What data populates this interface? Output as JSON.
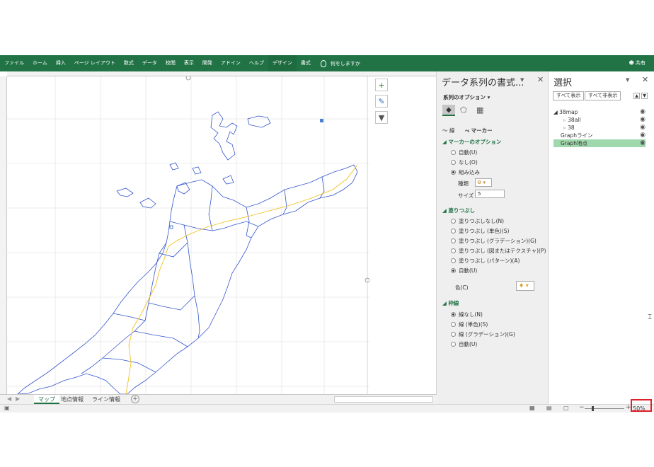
{
  "ribbon": {
    "tabs": [
      "ファイル",
      "ホーム",
      "挿入",
      "ページ レイアウト",
      "数式",
      "データ",
      "校閲",
      "表示",
      "開発",
      "アドイン",
      "ヘルプ",
      "デザイン",
      "書式"
    ],
    "tell_me": "何をしますか",
    "share": "共有"
  },
  "format_pane": {
    "title": "データ系列の書式...",
    "series_options": "系列のオプション",
    "line_tab": "線",
    "marker_tab": "マーカー",
    "marker_options": "マーカーのオプション",
    "marker_auto": "自動(U)",
    "marker_none": "なし(O)",
    "marker_builtin": "組み込み",
    "type_label": "種類",
    "size_label": "サイズ",
    "size_value": "5",
    "fill_section": "塗りつぶし",
    "fill_none": "塗りつぶしなし(N)",
    "fill_solid": "塗りつぶし (単色)(S)",
    "fill_gradient": "塗りつぶし (グラデーション)(G)",
    "fill_picture": "塗りつぶし (図またはテクスチャ)(P)",
    "fill_pattern": "塗りつぶし (パターン)(A)",
    "fill_auto": "自動(U)",
    "color_label": "色(C)",
    "border_section": "枠線",
    "border_none": "線なし(N)",
    "border_solid": "線 (単色)(S)",
    "border_gradient": "線 (グラデーション)(G)",
    "border_auto": "自動(U)"
  },
  "selection_pane": {
    "title": "選択",
    "show_all": "すべて表示",
    "hide_all": "すべて非表示",
    "items": [
      "38map",
      "38all",
      "38",
      "Graphライン",
      "Graph地点"
    ]
  },
  "sheet_tabs": [
    "マップ",
    "地点情報",
    "ライン情報"
  ],
  "zoom": "50%",
  "colors": {
    "excel_green": "#217346",
    "map_line": "#3355cc",
    "road_line": "#f0c020",
    "selected_item": "#9fd8ac",
    "highlight_box": "#e0202a"
  }
}
